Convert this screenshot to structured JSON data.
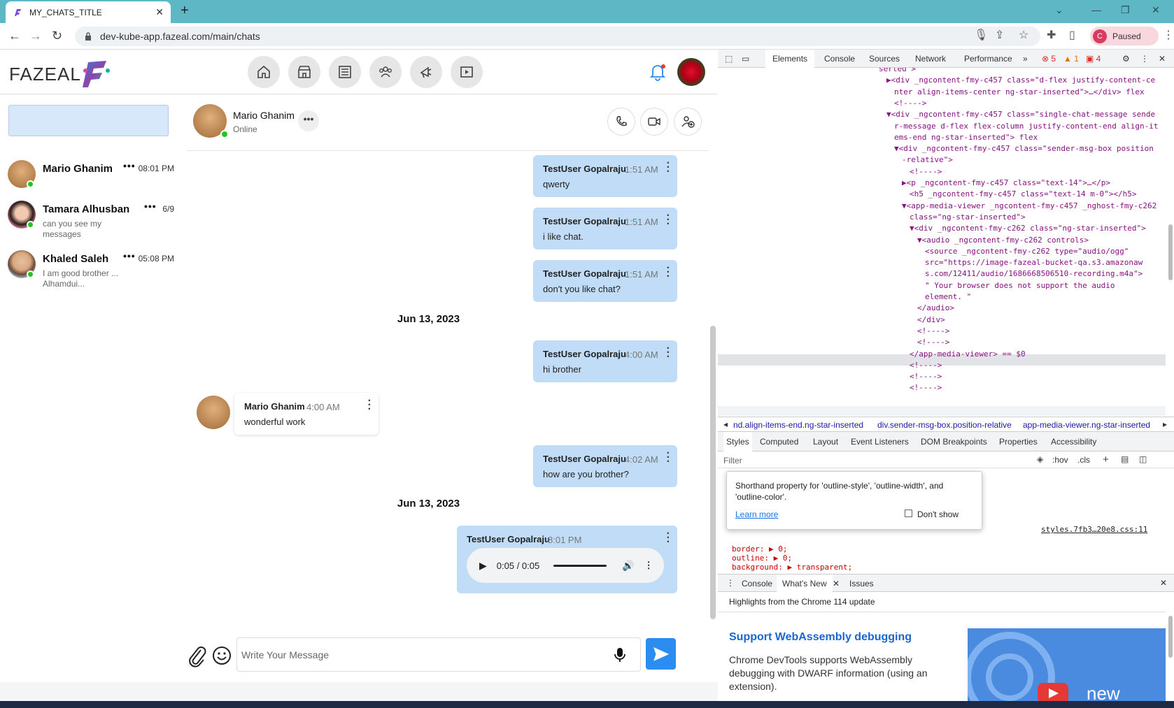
{
  "browser": {
    "tab_title": "MY_CHATS_TITLE",
    "url": "dev-kube-app.fazeal.com/main/chats",
    "profile_initial": "C",
    "profile_status": "Paused"
  },
  "app": {
    "brand": "FAZEAL",
    "nav_icons": [
      "home-icon",
      "store-icon",
      "newspaper-icon",
      "groups-icon",
      "megaphone-icon",
      "video-icon"
    ]
  },
  "sidebar": {
    "contacts": [
      {
        "name": "Mario Ghanim",
        "time": "08:01 PM",
        "preview": ""
      },
      {
        "name": "Tamara Alhusban",
        "time": "6/9",
        "preview": "can you see my messages"
      },
      {
        "name": "Khaled Saleh",
        "time": "05:08 PM",
        "preview": "I am good brother ... Alhamdui..."
      }
    ]
  },
  "chat": {
    "peer_name": "Mario Ghanim",
    "peer_status": "Online",
    "input_placeholder": "Write Your Message",
    "messages": [
      {
        "who": "TestUser Gopalraju",
        "time": "1:51 AM",
        "text": "qwerty"
      },
      {
        "who": "TestUser Gopalraju",
        "time": "1:51 AM",
        "text": "i like chat."
      },
      {
        "who": "TestUser Gopalraju",
        "time": "1:51 AM",
        "text": "don't you like chat?"
      },
      {
        "who": "TestUser Gopalraju",
        "time": "4:00 AM",
        "text": "hi brother"
      },
      {
        "who": "Mario Ghanim",
        "time": "4:00 AM",
        "text": "wonderful work"
      },
      {
        "who": "TestUser Gopalraju",
        "time": "4:02 AM",
        "text": "how are you brother?"
      },
      {
        "who": "TestUser Gopalraju",
        "time": "8:01 PM",
        "text": ""
      }
    ],
    "date_separators": [
      "Jun 13, 2023",
      "Jun 13, 2023"
    ],
    "audio_time": "0:05 / 0:05"
  },
  "devtools": {
    "tabs": [
      "Elements",
      "Console",
      "Sources",
      "Network",
      "Performance"
    ],
    "errors": "5",
    "warnings": "1",
    "issues": "4",
    "dom_lines": [
      {
        "i": 0,
        "t": "serted\">"
      },
      {
        "i": 1,
        "t": "▶<div _ngcontent-fmy-c457 class=\"d-flex justify-content-ce"
      },
      {
        "i": 2,
        "t": "nter align-items-center ng-star-inserted\">…</div> flex"
      },
      {
        "i": 2,
        "t": "<!---->"
      },
      {
        "i": 1,
        "t": "▼<div _ngcontent-fmy-c457 class=\"single-chat-message sende"
      },
      {
        "i": 2,
        "t": "r-message d-flex flex-column justify-content-end align-it"
      },
      {
        "i": 2,
        "t": "ems-end ng-star-inserted\"> flex"
      },
      {
        "i": 2,
        "t": "▼<div _ngcontent-fmy-c457 class=\"sender-msg-box position"
      },
      {
        "i": 3,
        "t": "-relative\">"
      },
      {
        "i": 4,
        "t": "<!---->"
      },
      {
        "i": 3,
        "t": "▶<p _ngcontent-fmy-c457 class=\"text-14\">…</p>"
      },
      {
        "i": 4,
        "t": "<h5 _ngcontent-fmy-c457 class=\"text-14 m-0\"></h5>"
      },
      {
        "i": 3,
        "t": "▼<app-media-viewer _ngcontent-fmy-c457 _nghost-fmy-c262"
      },
      {
        "i": 4,
        "t": "class=\"ng-star-inserted\">"
      },
      {
        "i": 4,
        "t": "▼<div _ngcontent-fmy-c262 class=\"ng-star-inserted\">"
      },
      {
        "i": 5,
        "t": "▼<audio _ngcontent-fmy-c262 controls>"
      },
      {
        "i": 6,
        "t": "<source _ngcontent-fmy-c262 type=\"audio/ogg\""
      },
      {
        "i": 6,
        "t": "src=\"https://image-fazeal-bucket-qa.s3.amazonaw"
      },
      {
        "i": 6,
        "t": "s.com/12411/audio/1686668506510-recording.m4a\">"
      },
      {
        "i": 6,
        "t": "\" Your browser does not support the audio"
      },
      {
        "i": 6,
        "t": "element. \""
      },
      {
        "i": 5,
        "t": "</audio>"
      },
      {
        "i": 5,
        "t": "</div>"
      },
      {
        "i": 5,
        "t": "<!---->"
      },
      {
        "i": 5,
        "t": "<!---->"
      },
      {
        "i": 4,
        "t": "</app-media-viewer> == $0"
      },
      {
        "i": 4,
        "t": "<!---->"
      },
      {
        "i": 4,
        "t": "<!---->"
      },
      {
        "i": 4,
        "t": "<!---->"
      }
    ],
    "breadcrumbs": [
      "nd.align-items-end.ng-star-inserted",
      "div.sender-msg-box.position-relative",
      "app-media-viewer.ng-star-inserted"
    ],
    "style_tabs": [
      "Styles",
      "Computed",
      "Layout",
      "Event Listeners",
      "DOM Breakpoints",
      "Properties",
      "Accessibility"
    ],
    "filter_label": "Filter",
    "hov": ":hov",
    "cls": ".cls",
    "tooltip_text": "Shorthand property for 'outline-style', 'outline-width', and 'outline-color'.",
    "tooltip_link": "Learn more",
    "tooltip_checkbox": "Don't show",
    "stylesheet_link": "styles.7fb3…20e8.css:11",
    "css_lines": [
      "border: ▶ 0;",
      "outline: ▶ 0;",
      "background: ▶ transparent;"
    ],
    "drawer_tabs": [
      "Console",
      "What's New",
      "Issues"
    ],
    "whats_new_header": "Highlights from the Chrome 114 update",
    "whats_new_title": "Support WebAssembly debugging",
    "whats_new_body": "Chrome DevTools supports WebAssembly debugging with DWARF information (using an extension).",
    "whats_new_badge": "new"
  }
}
